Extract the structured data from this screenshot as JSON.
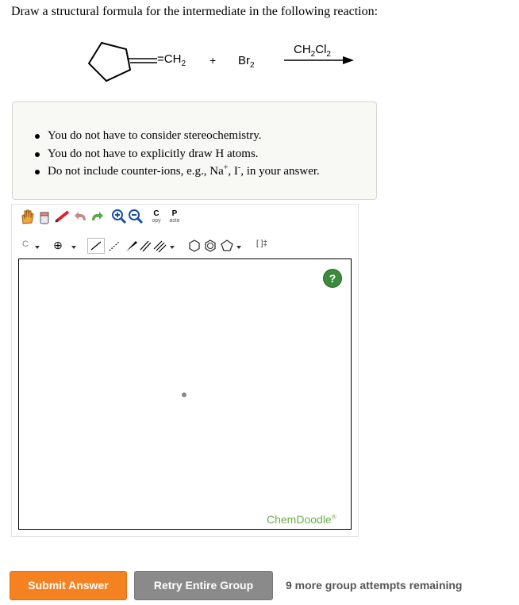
{
  "question": "Draw a structural formula for the intermediate in the following reaction:",
  "reaction": {
    "reactant1_group": "=CH",
    "reactant1_sub": "2",
    "plus": "+",
    "reactant2": "Br",
    "reactant2_sub": "2",
    "solvent_a": "CH",
    "solvent_sub1": "2",
    "solvent_b": "Cl",
    "solvent_sub2": "2"
  },
  "notes": {
    "item1": "You do not have to consider stereochemistry.",
    "item2": "You do not have to explicitly draw H atoms.",
    "item3_pre": "Do not include counter-ions, e.g., Na",
    "item3_sup1": "+",
    "item3_mid": ", I",
    "item3_sup2": "-",
    "item3_post": ", in your answer."
  },
  "toolbar": {
    "copy_top": "C",
    "copy_bottom": "opy",
    "paste_top": "P",
    "paste_bottom": "aste",
    "element_label": "C",
    "charge_label": "⊕",
    "bracket_label": "[ ]‡"
  },
  "editor": {
    "help": "?",
    "brand": "ChemDoodle",
    "brand_mark": "®"
  },
  "buttons": {
    "submit": "Submit Answer",
    "retry": "Retry Entire Group"
  },
  "attempts": "9 more group attempts remaining",
  "colors": {
    "submit": "#f58220",
    "retry": "#8a8a8a",
    "help": "#3d8a3f",
    "brand": "#6fae4a"
  }
}
